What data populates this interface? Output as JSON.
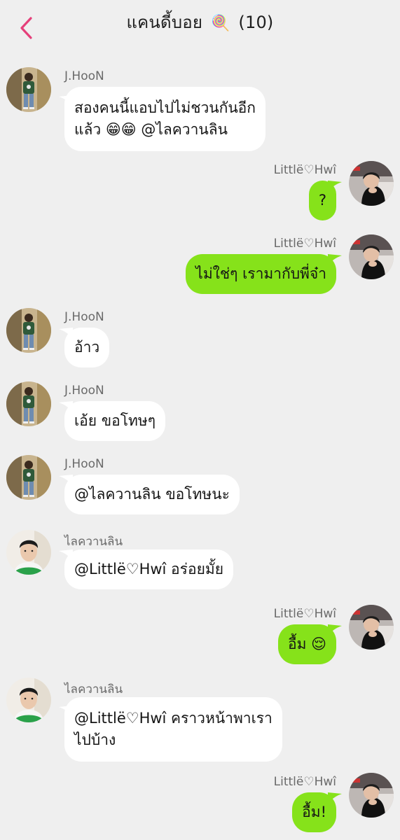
{
  "header": {
    "back_icon": "chevron-left-icon",
    "title": "แคนดี้บอย",
    "title_emoji": "🍭",
    "member_count": "(10)",
    "accent": "#e5407a"
  },
  "colors": {
    "background": "#efefef",
    "incoming_bubble": "#ffffff",
    "outgoing_bubble": "#86e21a"
  },
  "messages": [
    {
      "sender": "J.HooN",
      "lines": [
        "สองคนนี้แอบไปไม่ชวนกันอีก",
        "แล้ว 😁😁 @ไลควานลิน"
      ]
    },
    {
      "sender": "Littlë♡Hwî",
      "text": "?"
    },
    {
      "sender": "Littlë♡Hwî",
      "text": "ไม่ใช่ๆ เรามากับพี่จ๋า"
    },
    {
      "sender": "J.HooN",
      "text": "อ้าว"
    },
    {
      "sender": "J.HooN",
      "text": "เอ้ย ขอโทษๆ"
    },
    {
      "sender": "J.HooN",
      "text": "@ไลควานลิน ขอโทษนะ"
    },
    {
      "sender": "ไลควานลิน",
      "text": "@Littlë♡Hwî อร่อยมั้ย"
    },
    {
      "sender": "Littlë♡Hwî",
      "text": "อื้ม 😌"
    },
    {
      "sender": "ไลควานลิน",
      "lines": [
        "@Littlë♡Hwî คราวหน้าพาเรา",
        "ไปบ้าง"
      ]
    },
    {
      "sender": "Littlë♡Hwî",
      "text": "อื้ม!"
    }
  ]
}
